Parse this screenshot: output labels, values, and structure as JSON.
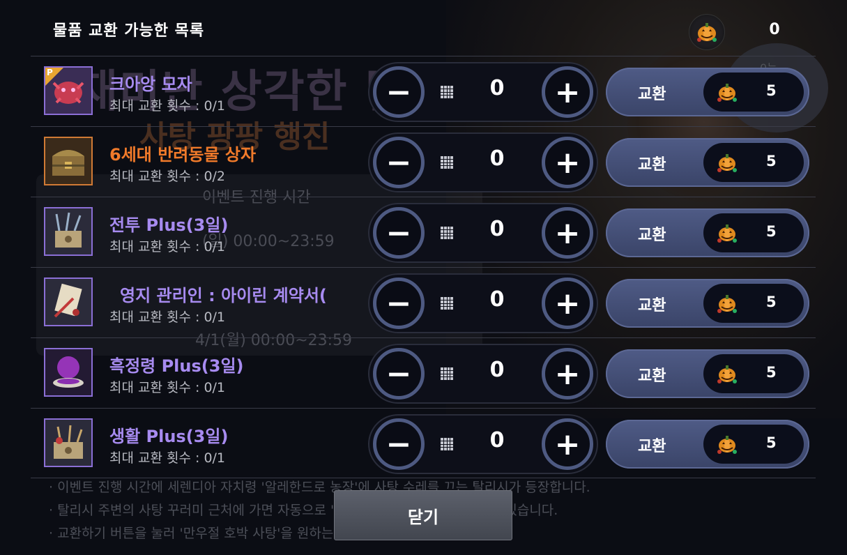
{
  "background": {
    "event_title_line1": "재미난 상각한 탈리",
    "event_title_line2": "사탕 팡팡 행진",
    "event_period_heading": "이벤트 진행 시간",
    "event_period_1": "(일) 00:00~23:59",
    "event_period_2": "4/1(월) 00:00~23:59",
    "speech_bubble": "0는",
    "notes": [
      "· 이벤트 진행 시간에 세렌디아 자치령 '알레한드로 농장'에 사탕 수레를 끄는 탈리시가 등장합니다.",
      "· 탈리시 주변의 사탕 꾸러미 근처에 가면 자동으로 '만우절 호박 사탕'을 획득할 수 있습니다.",
      "· 교환하기 버튼을 눌러 '만우절 호박 사탕'을 원하는 아이템으로 교환하세요."
    ]
  },
  "header": {
    "title": "물품 교환 가능한 목록",
    "currency_icon": "pumpkin-candy-icon",
    "currency_count": "0"
  },
  "items": [
    {
      "name": "크아앙 모자",
      "limit": "최대 교환 횟수 : 0/1",
      "qty": "0",
      "cost": "5",
      "exchange_label": "교환",
      "icon": "crab-hat-icon",
      "name_color": "#a78bf0",
      "premium_badge": "P"
    },
    {
      "name": "6세대 반려동물 상자",
      "limit": "최대 교환 횟수 : 0/2",
      "qty": "0",
      "cost": "5",
      "exchange_label": "교환",
      "icon": "pet-box-icon",
      "name_color": "#f07a2a"
    },
    {
      "name": "전투 Plus(3일)",
      "limit": "최대 교환 횟수 : 0/1",
      "qty": "0",
      "cost": "5",
      "exchange_label": "교환",
      "icon": "combat-crate-icon",
      "name_color": "#a78bf0"
    },
    {
      "name": "영지 관리인 : 아이린 계약서(",
      "limit": "최대 교환 횟수 : 0/1",
      "qty": "0",
      "cost": "5",
      "exchange_label": "교환",
      "icon": "contract-scroll-icon",
      "name_color": "#a78bf0"
    },
    {
      "name": "흑정령 Plus(3일)",
      "limit": "최대 교환 횟수 : 0/1",
      "qty": "0",
      "cost": "5",
      "exchange_label": "교환",
      "icon": "dark-spirit-bowl-icon",
      "name_color": "#a78bf0"
    },
    {
      "name": "생활 Plus(3일)",
      "limit": "최대 교환 횟수 : 0/1",
      "qty": "0",
      "cost": "5",
      "exchange_label": "교환",
      "icon": "life-crate-icon",
      "name_color": "#a78bf0"
    }
  ],
  "stepper": {
    "minus": "−",
    "plus": "+"
  },
  "footer": {
    "close_label": "닫기"
  }
}
